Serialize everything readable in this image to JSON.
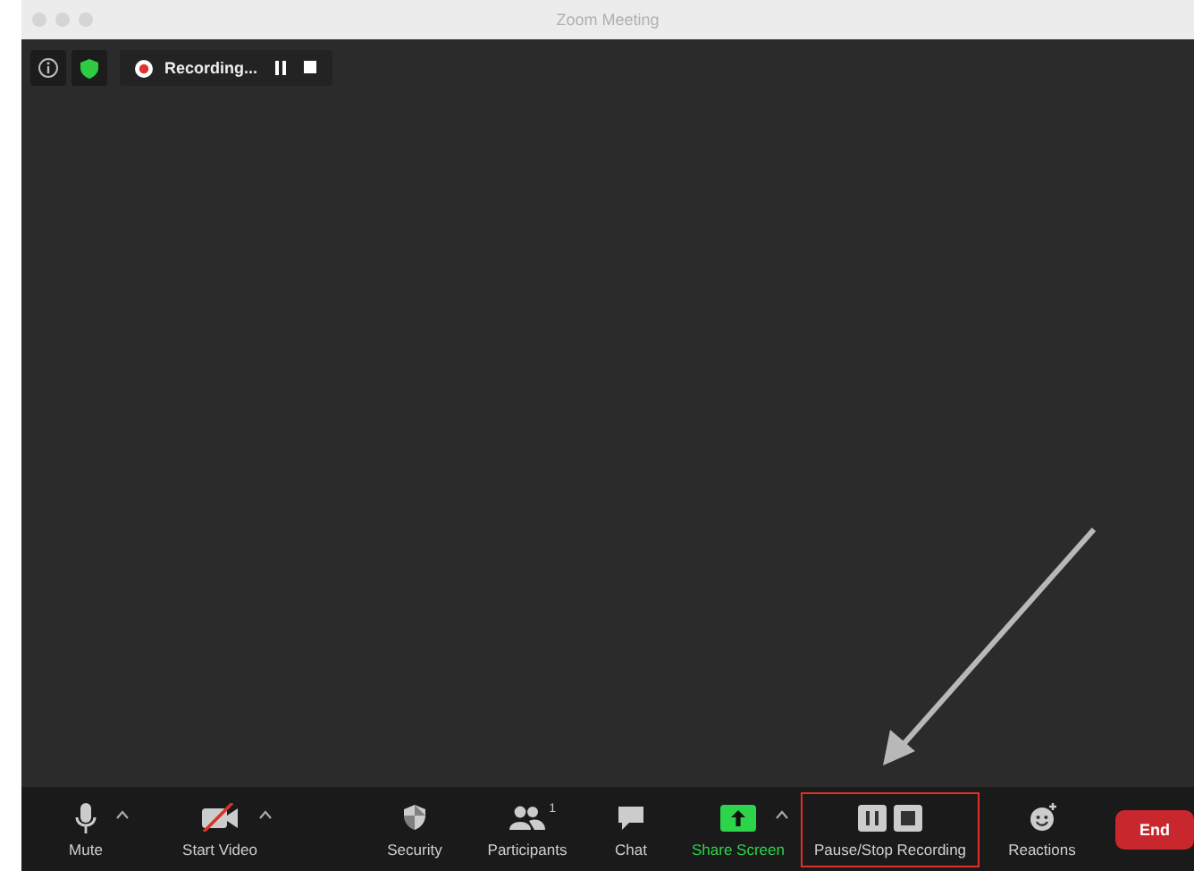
{
  "window": {
    "title": "Zoom Meeting"
  },
  "recording": {
    "label": "Recording..."
  },
  "toolbar": [
    {
      "kind": "mic",
      "label": "Mute",
      "caret": true
    },
    {
      "kind": "video",
      "label": "Start Video",
      "caret": true
    },
    {
      "kind": "security",
      "label": "Security",
      "caret": false
    },
    {
      "kind": "participants",
      "label": "Participants",
      "count": "1",
      "caret": false
    },
    {
      "kind": "chat",
      "label": "Chat",
      "caret": false
    },
    {
      "kind": "share",
      "label": "Share Screen",
      "caret": true
    },
    {
      "kind": "recording",
      "label": "Pause/Stop Recording",
      "caret": false,
      "highlighted": true
    },
    {
      "kind": "reactions",
      "label": "Reactions",
      "caret": false
    }
  ],
  "end_button": "End"
}
